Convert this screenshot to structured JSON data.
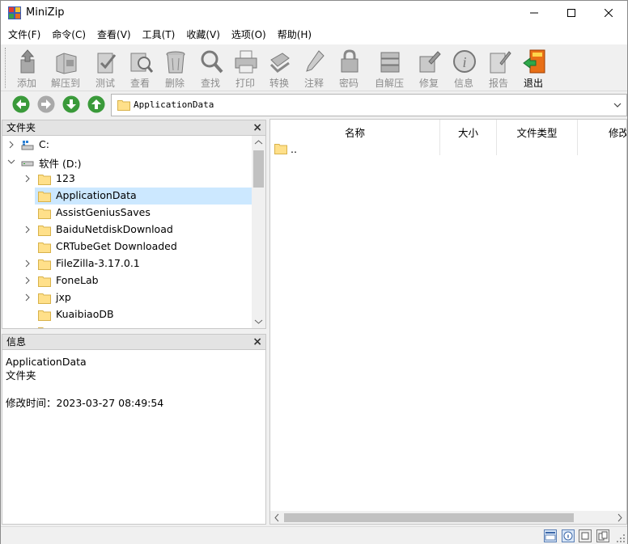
{
  "window": {
    "title": "MiniZip"
  },
  "menu": [
    "文件(F)",
    "命令(C)",
    "查看(V)",
    "工具(T)",
    "收藏(V)",
    "选项(O)",
    "帮助(H)"
  ],
  "toolbar": [
    {
      "label": "添加",
      "icon": "add-icon"
    },
    {
      "label": "解压到",
      "icon": "extract-icon"
    },
    {
      "label": "测试",
      "icon": "test-icon"
    },
    {
      "label": "查看",
      "icon": "view-icon"
    },
    {
      "label": "删除",
      "icon": "delete-icon"
    },
    {
      "label": "查找",
      "icon": "find-icon"
    },
    {
      "label": "打印",
      "icon": "print-icon"
    },
    {
      "label": "转换",
      "icon": "convert-icon"
    },
    {
      "label": "注释",
      "icon": "comment-icon"
    },
    {
      "label": "密码",
      "icon": "password-icon"
    },
    {
      "label": "自解压",
      "icon": "sfx-icon"
    },
    {
      "label": "修复",
      "icon": "repair-icon"
    },
    {
      "label": "信息",
      "icon": "info-icon"
    },
    {
      "label": "报告",
      "icon": "report-icon"
    },
    {
      "label": "退出",
      "icon": "exit-icon"
    }
  ],
  "address": {
    "path": "ApplicationData"
  },
  "folders_panel": {
    "title": "文件夹",
    "close": "×",
    "items": [
      {
        "label": "C:",
        "type": "drive",
        "expanded": false
      },
      {
        "label": "软件 (D:)",
        "type": "drive",
        "expanded": true
      },
      {
        "label": "123",
        "type": "folder",
        "expandable": true
      },
      {
        "label": "ApplicationData",
        "type": "folder",
        "expandable": false,
        "selected": true
      },
      {
        "label": "AssistGeniusSaves",
        "type": "folder",
        "expandable": false
      },
      {
        "label": "BaiduNetdiskDownload",
        "type": "folder",
        "expandable": true
      },
      {
        "label": "CRTubeGet Downloaded",
        "type": "folder",
        "expandable": false
      },
      {
        "label": "FileZilla-3.17.0.1",
        "type": "folder",
        "expandable": true
      },
      {
        "label": "FoneLab",
        "type": "folder",
        "expandable": true
      },
      {
        "label": "jxp",
        "type": "folder",
        "expandable": true
      },
      {
        "label": "KuaibiaoDB",
        "type": "folder",
        "expandable": false
      }
    ]
  },
  "info_panel": {
    "title": "信息",
    "close": "×",
    "name": "ApplicationData",
    "type": "文件夹",
    "modified": "修改时间：2023-03-27 08:49:54"
  },
  "file_list": {
    "columns": [
      "名称",
      "大小",
      "文件类型",
      "修改"
    ],
    "rows": [
      {
        "name": ".."
      }
    ]
  },
  "colors": {
    "selection": "#cce8ff",
    "folder": "#ffe08a"
  }
}
